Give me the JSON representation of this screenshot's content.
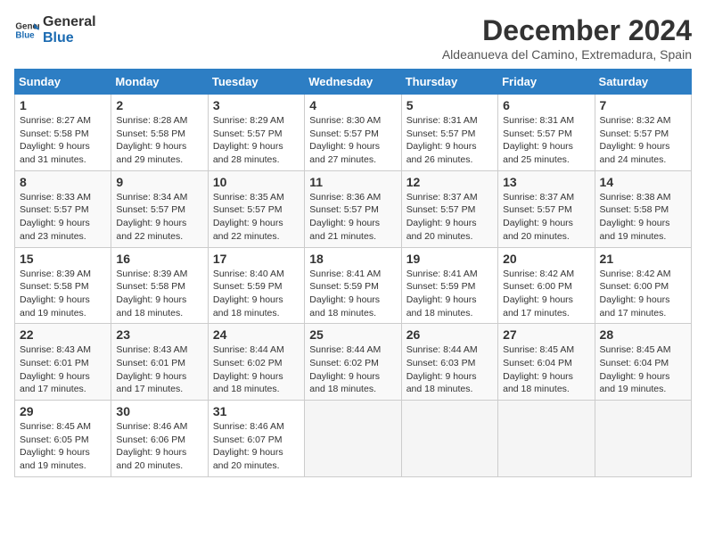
{
  "header": {
    "logo_line1": "General",
    "logo_line2": "Blue",
    "month": "December 2024",
    "location": "Aldeanueva del Camino, Extremadura, Spain"
  },
  "days_of_week": [
    "Sunday",
    "Monday",
    "Tuesday",
    "Wednesday",
    "Thursday",
    "Friday",
    "Saturday"
  ],
  "weeks": [
    [
      {
        "day": "1",
        "sunrise": "8:27 AM",
        "sunset": "5:58 PM",
        "daylight": "9 hours and 31 minutes."
      },
      {
        "day": "2",
        "sunrise": "8:28 AM",
        "sunset": "5:58 PM",
        "daylight": "9 hours and 29 minutes."
      },
      {
        "day": "3",
        "sunrise": "8:29 AM",
        "sunset": "5:57 PM",
        "daylight": "9 hours and 28 minutes."
      },
      {
        "day": "4",
        "sunrise": "8:30 AM",
        "sunset": "5:57 PM",
        "daylight": "9 hours and 27 minutes."
      },
      {
        "day": "5",
        "sunrise": "8:31 AM",
        "sunset": "5:57 PM",
        "daylight": "9 hours and 26 minutes."
      },
      {
        "day": "6",
        "sunrise": "8:31 AM",
        "sunset": "5:57 PM",
        "daylight": "9 hours and 25 minutes."
      },
      {
        "day": "7",
        "sunrise": "8:32 AM",
        "sunset": "5:57 PM",
        "daylight": "9 hours and 24 minutes."
      }
    ],
    [
      {
        "day": "8",
        "sunrise": "8:33 AM",
        "sunset": "5:57 PM",
        "daylight": "9 hours and 23 minutes."
      },
      {
        "day": "9",
        "sunrise": "8:34 AM",
        "sunset": "5:57 PM",
        "daylight": "9 hours and 22 minutes."
      },
      {
        "day": "10",
        "sunrise": "8:35 AM",
        "sunset": "5:57 PM",
        "daylight": "9 hours and 22 minutes."
      },
      {
        "day": "11",
        "sunrise": "8:36 AM",
        "sunset": "5:57 PM",
        "daylight": "9 hours and 21 minutes."
      },
      {
        "day": "12",
        "sunrise": "8:37 AM",
        "sunset": "5:57 PM",
        "daylight": "9 hours and 20 minutes."
      },
      {
        "day": "13",
        "sunrise": "8:37 AM",
        "sunset": "5:57 PM",
        "daylight": "9 hours and 20 minutes."
      },
      {
        "day": "14",
        "sunrise": "8:38 AM",
        "sunset": "5:58 PM",
        "daylight": "9 hours and 19 minutes."
      }
    ],
    [
      {
        "day": "15",
        "sunrise": "8:39 AM",
        "sunset": "5:58 PM",
        "daylight": "9 hours and 19 minutes."
      },
      {
        "day": "16",
        "sunrise": "8:39 AM",
        "sunset": "5:58 PM",
        "daylight": "9 hours and 18 minutes."
      },
      {
        "day": "17",
        "sunrise": "8:40 AM",
        "sunset": "5:59 PM",
        "daylight": "9 hours and 18 minutes."
      },
      {
        "day": "18",
        "sunrise": "8:41 AM",
        "sunset": "5:59 PM",
        "daylight": "9 hours and 18 minutes."
      },
      {
        "day": "19",
        "sunrise": "8:41 AM",
        "sunset": "5:59 PM",
        "daylight": "9 hours and 18 minutes."
      },
      {
        "day": "20",
        "sunrise": "8:42 AM",
        "sunset": "6:00 PM",
        "daylight": "9 hours and 17 minutes."
      },
      {
        "day": "21",
        "sunrise": "8:42 AM",
        "sunset": "6:00 PM",
        "daylight": "9 hours and 17 minutes."
      }
    ],
    [
      {
        "day": "22",
        "sunrise": "8:43 AM",
        "sunset": "6:01 PM",
        "daylight": "9 hours and 17 minutes."
      },
      {
        "day": "23",
        "sunrise": "8:43 AM",
        "sunset": "6:01 PM",
        "daylight": "9 hours and 17 minutes."
      },
      {
        "day": "24",
        "sunrise": "8:44 AM",
        "sunset": "6:02 PM",
        "daylight": "9 hours and 18 minutes."
      },
      {
        "day": "25",
        "sunrise": "8:44 AM",
        "sunset": "6:02 PM",
        "daylight": "9 hours and 18 minutes."
      },
      {
        "day": "26",
        "sunrise": "8:44 AM",
        "sunset": "6:03 PM",
        "daylight": "9 hours and 18 minutes."
      },
      {
        "day": "27",
        "sunrise": "8:45 AM",
        "sunset": "6:04 PM",
        "daylight": "9 hours and 18 minutes."
      },
      {
        "day": "28",
        "sunrise": "8:45 AM",
        "sunset": "6:04 PM",
        "daylight": "9 hours and 19 minutes."
      }
    ],
    [
      {
        "day": "29",
        "sunrise": "8:45 AM",
        "sunset": "6:05 PM",
        "daylight": "9 hours and 19 minutes."
      },
      {
        "day": "30",
        "sunrise": "8:46 AM",
        "sunset": "6:06 PM",
        "daylight": "9 hours and 20 minutes."
      },
      {
        "day": "31",
        "sunrise": "8:46 AM",
        "sunset": "6:07 PM",
        "daylight": "9 hours and 20 minutes."
      },
      null,
      null,
      null,
      null
    ]
  ],
  "labels": {
    "sunrise": "Sunrise:",
    "sunset": "Sunset:",
    "daylight": "Daylight:"
  }
}
